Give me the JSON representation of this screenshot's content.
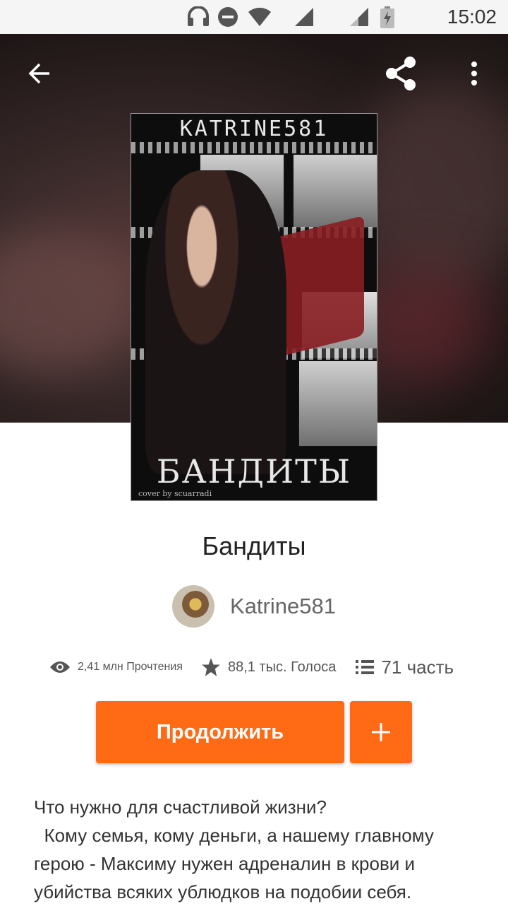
{
  "status_bar": {
    "time": "15:02"
  },
  "cover": {
    "author_text": "KATRINE581",
    "title_text": "БАНДИТЫ",
    "credit_text": "cover by scuarradi"
  },
  "story": {
    "title": "Бандиты",
    "author": "Katrine581",
    "stats": {
      "reads": "2,41 млн Прочтения",
      "votes": "88,1 тыс. Голоса",
      "parts": "71 часть"
    }
  },
  "actions": {
    "continue_label": "Продолжить",
    "add_label": "+"
  },
  "description": [
    "Что нужно для счастливой жизни?",
    "  Кому семья, кому деньги, а нашему главному герою - Максиму нужен адреналин в крови и убийства всяких ублюдков на подобии себя."
  ],
  "colors": {
    "accent": "#ff6a14"
  }
}
